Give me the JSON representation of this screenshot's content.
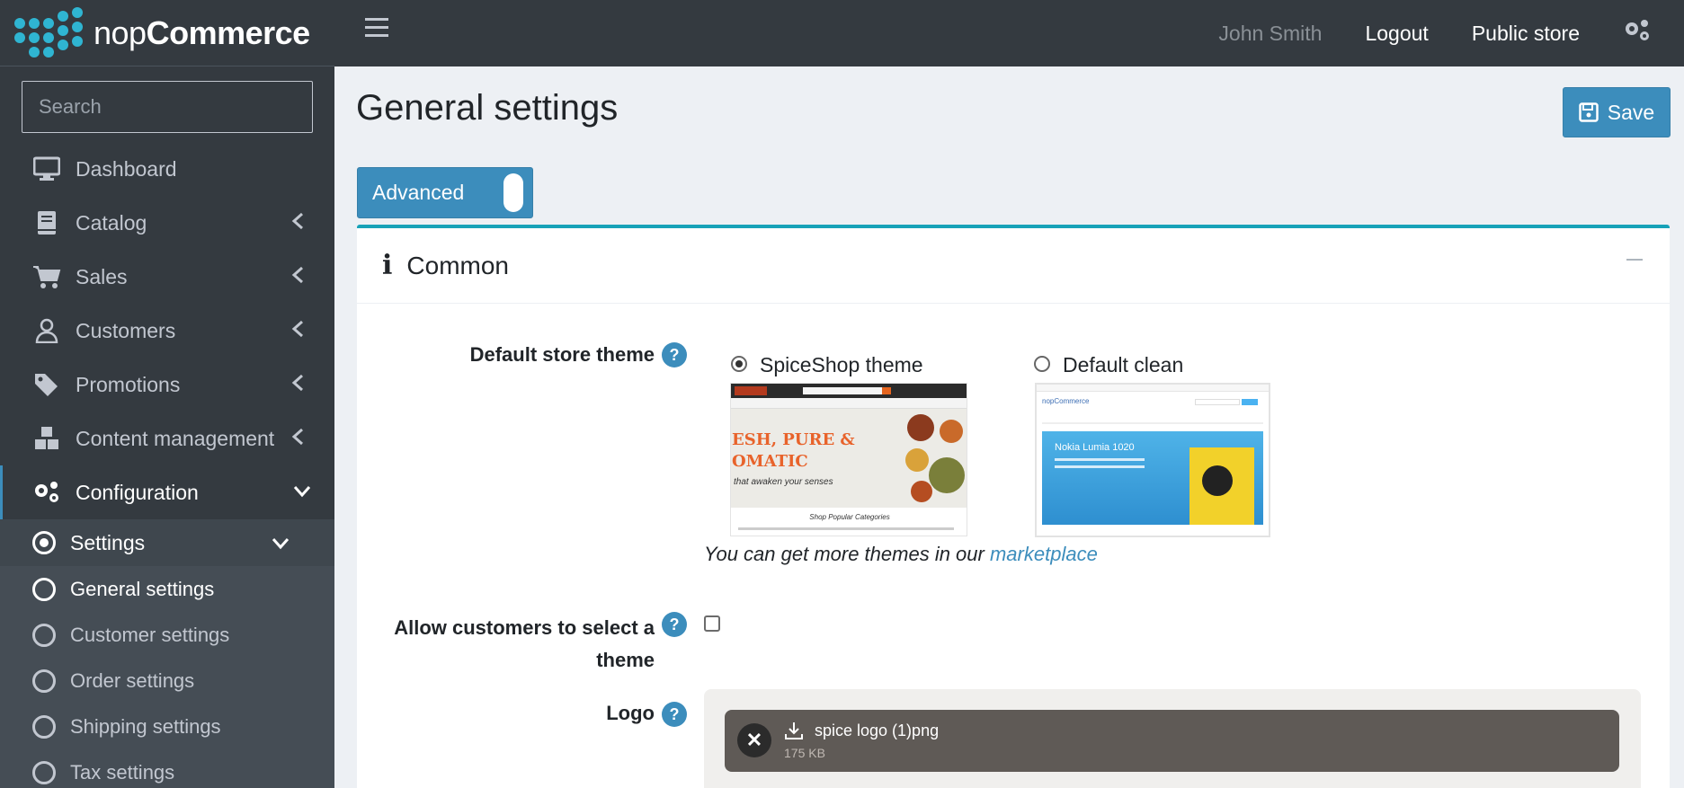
{
  "brand": {
    "name_light": "nop",
    "name_bold": "Commerce",
    "accent": "#2fb5d2"
  },
  "search": {
    "placeholder": "Search"
  },
  "header": {
    "user": "John Smith",
    "logout": "Logout",
    "public_store": "Public store"
  },
  "sidebar": {
    "items": [
      {
        "label": "Dashboard",
        "icon": "monitor-icon"
      },
      {
        "label": "Catalog",
        "icon": "book-icon"
      },
      {
        "label": "Sales",
        "icon": "cart-icon"
      },
      {
        "label": "Customers",
        "icon": "user-icon"
      },
      {
        "label": "Promotions",
        "icon": "tags-icon"
      },
      {
        "label": "Content management",
        "icon": "cubes-icon"
      },
      {
        "label": "Configuration",
        "icon": "gears-icon"
      }
    ],
    "settings_label": "Settings",
    "sub_items": [
      {
        "label": "General settings"
      },
      {
        "label": "Customer settings"
      },
      {
        "label": "Order settings"
      },
      {
        "label": "Shipping settings"
      },
      {
        "label": "Tax settings"
      }
    ]
  },
  "page": {
    "title": "General settings",
    "save_label": "Save",
    "advanced_label": "Advanced"
  },
  "card": {
    "title": "Common",
    "fields": {
      "theme_label": "Default store theme",
      "themes": [
        {
          "name": "SpiceShop theme",
          "selected": true
        },
        {
          "name": "Default clean",
          "selected": false
        }
      ],
      "hint_prefix": "You can get more themes in our ",
      "hint_link": "marketplace",
      "allow_label_line1": "Allow customers to select a",
      "allow_label_line2": "theme",
      "allow_checked": false,
      "logo_label": "Logo",
      "logo_file": {
        "name": "spice logo (1)png",
        "size": "175 KB"
      }
    }
  },
  "thumbs": {
    "spice_headline1": "ESH, PURE &",
    "spice_headline2": "OMATIC",
    "spice_tagline": "that awaken your senses",
    "spice_section": "Shop Popular Categories",
    "clean_hero": "Nokia Lumia 1020",
    "clean_logo": "nopCommerce"
  }
}
